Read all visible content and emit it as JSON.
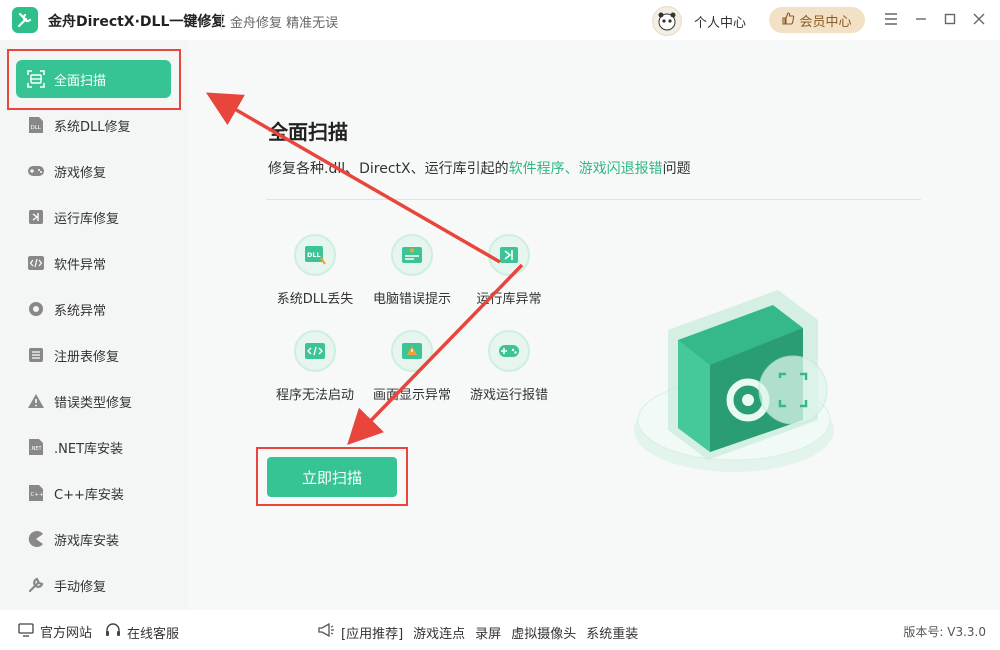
{
  "titlebar": {
    "app_title": "金舟DirectX·DLL一键修复",
    "subtitle": "金舟修复 精准无误",
    "user_center": "个人中心",
    "vip_center": "会员中心"
  },
  "sidebar": {
    "items": [
      {
        "label": "全面扫描",
        "icon": "scan-icon"
      },
      {
        "label": "系统DLL修复",
        "icon": "dll-icon"
      },
      {
        "label": "游戏修复",
        "icon": "gamepad-icon"
      },
      {
        "label": "运行库修复",
        "icon": "runtime-icon"
      },
      {
        "label": "软件异常",
        "icon": "code-icon"
      },
      {
        "label": "系统异常",
        "icon": "gear-icon"
      },
      {
        "label": "注册表修复",
        "icon": "list-icon"
      },
      {
        "label": "错误类型修复",
        "icon": "warning-icon"
      },
      {
        "label": ".NET库安装",
        "icon": "net-icon"
      },
      {
        "label": "C++库安装",
        "icon": "cpp-icon"
      },
      {
        "label": "游戏库安装",
        "icon": "pacman-icon"
      },
      {
        "label": "手动修复",
        "icon": "wrench-icon"
      }
    ]
  },
  "main": {
    "title": "全面扫描",
    "desc_prefix": "修复各种.dll、DirectX、运行库引起的",
    "desc_highlight": "软件程序、游戏闪退报错",
    "desc_suffix": "问题",
    "features": [
      {
        "label": "系统DLL丢失",
        "icon": "dll-file-icon"
      },
      {
        "label": "电脑错误提示",
        "icon": "error-window-icon"
      },
      {
        "label": "运行库异常",
        "icon": "vs-runtime-icon"
      },
      {
        "label": "程序无法启动",
        "icon": "code-window-icon"
      },
      {
        "label": "画面显示异常",
        "icon": "display-warning-icon"
      },
      {
        "label": "游戏运行报错",
        "icon": "gamepad-icon"
      }
    ],
    "scan_button": "立即扫描"
  },
  "footer": {
    "official_site": "官方网站",
    "online_service": "在线客服",
    "app_recommend": "[应用推荐]",
    "links": [
      "游戏连点",
      "录屏",
      "虚拟摄像头",
      "系统重装"
    ],
    "version": "版本号: V3.3.0"
  },
  "colors": {
    "accent": "#37c495",
    "highlight": "#2fb883",
    "annotation": "#e8453c",
    "vip_bg": "#f3e1c5"
  }
}
